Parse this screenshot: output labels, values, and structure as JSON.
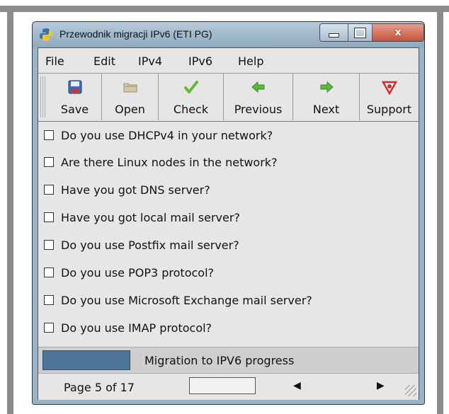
{
  "window": {
    "title": "Przewodnik migracji IPv6 (ETI PG)",
    "controls": {
      "minimize": "–",
      "maximize": "□",
      "close": "x"
    }
  },
  "menu": [
    "File",
    "Edit",
    "IPv4",
    "IPv6",
    "Help"
  ],
  "toolbar": {
    "save": "Save",
    "open": "Open",
    "check": "Check",
    "previous": "Previous",
    "next": "Next",
    "support": "Support"
  },
  "questions": [
    "Do you use DHCPv4 in your network?",
    "Are there Linux nodes in the network?",
    "Have you got DNS server?",
    "Have you got local mail server?",
    "Do you use Postfix mail server?",
    "Do you use POP3 protocol?",
    "Do you use Microsoft Exchange mail server?",
    "Do you use IMAP protocol?"
  ],
  "progress": {
    "label": "Migration to IPV6 progress",
    "fraction": 0.29,
    "color": "#4f7699"
  },
  "status": {
    "page": "Page 5 of 17",
    "arrow_left": "◀",
    "arrow_right": "▶"
  },
  "icons": {
    "save": "floppy-disk-icon",
    "open": "folder-icon",
    "check": "checkmark-icon",
    "previous": "left-arrow-icon",
    "next": "right-arrow-icon",
    "support": "lifebuoy-icon"
  }
}
